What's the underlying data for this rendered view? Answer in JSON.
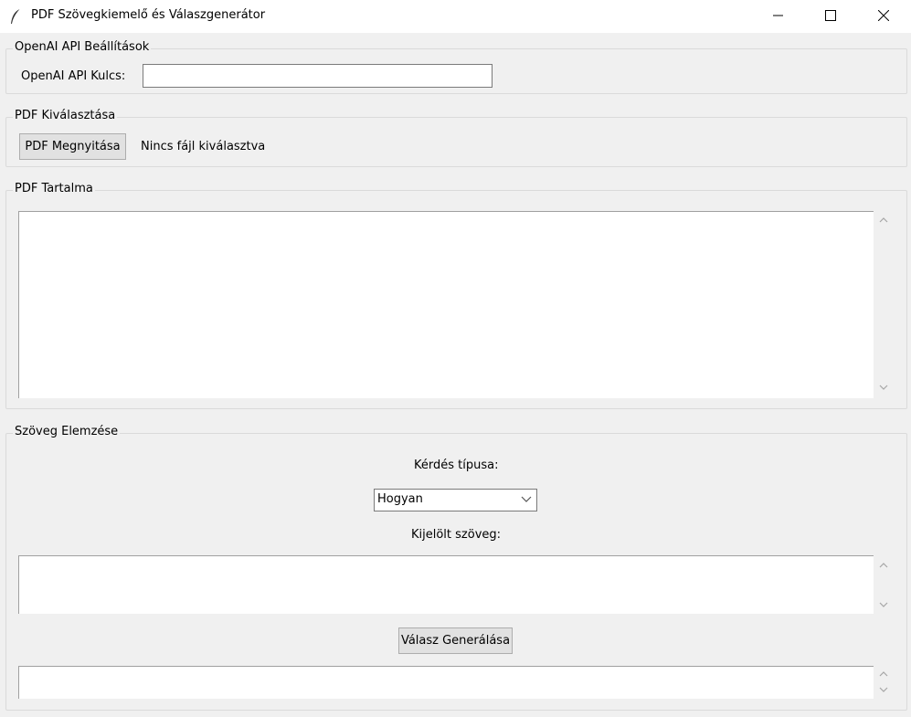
{
  "window": {
    "title": "PDF Szövegkiemelő és Válaszgenerátor",
    "icon": "feather-icon",
    "controls": [
      "minimize-icon",
      "maximize-icon",
      "close-icon"
    ]
  },
  "api_settings": {
    "group_label": "OpenAI API Beállítások",
    "key_label": "OpenAI API Kulcs:",
    "key_value": ""
  },
  "pdf_select": {
    "group_label": "PDF Kiválasztása",
    "open_button": "PDF Megnyitása",
    "status": "Nincs fájl kiválasztva"
  },
  "pdf_content": {
    "group_label": "PDF Tartalma",
    "text": ""
  },
  "analysis": {
    "group_label": "Szöveg Elemzése",
    "question_type_label": "Kérdés típusa:",
    "question_type_value": "Hogyan",
    "selected_text_label": "Kijelölt szöveg:",
    "selected_text": "",
    "generate_button": "Válasz Generálása",
    "answer_text": ""
  }
}
